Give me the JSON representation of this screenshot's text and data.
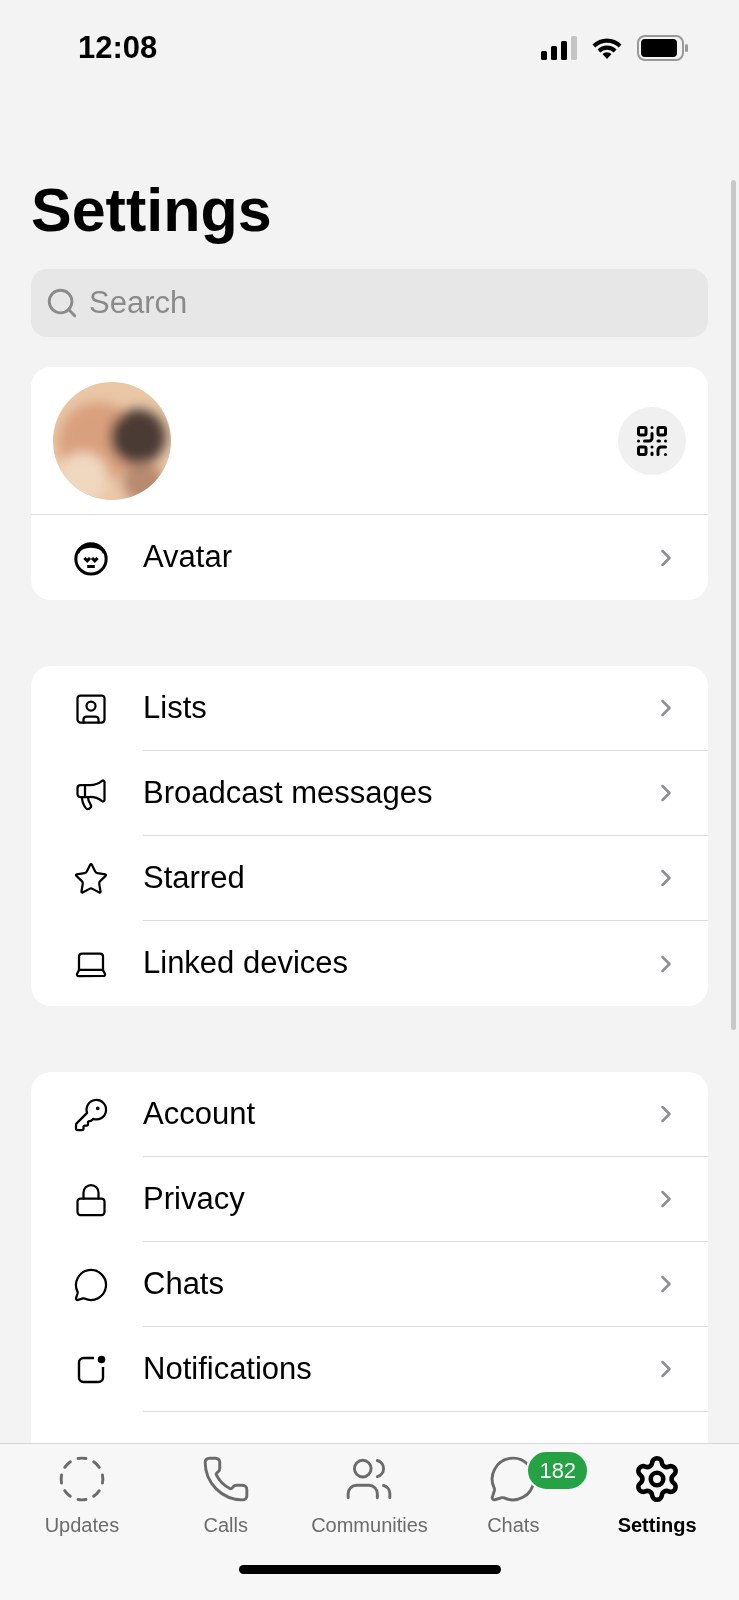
{
  "status_bar": {
    "time": "12:08"
  },
  "title": "Settings",
  "search": {
    "placeholder": "Search"
  },
  "profile": {
    "kind": "picture",
    "rows": [
      {
        "label": "Avatar"
      }
    ]
  },
  "groups": [
    {
      "rows": [
        {
          "label": "Lists"
        },
        {
          "label": "Broadcast messages"
        },
        {
          "label": "Starred"
        },
        {
          "label": "Linked devices"
        }
      ]
    },
    {
      "rows": [
        {
          "label": "Account"
        },
        {
          "label": "Privacy"
        },
        {
          "label": "Chats"
        },
        {
          "label": "Notifications"
        }
      ]
    }
  ],
  "tabs": [
    {
      "label": "Updates",
      "selected": false
    },
    {
      "label": "Calls",
      "selected": false
    },
    {
      "label": "Communities",
      "selected": false
    },
    {
      "label": "Chats",
      "selected": false,
      "badge": "182"
    },
    {
      "label": "Settings",
      "selected": true
    }
  ]
}
